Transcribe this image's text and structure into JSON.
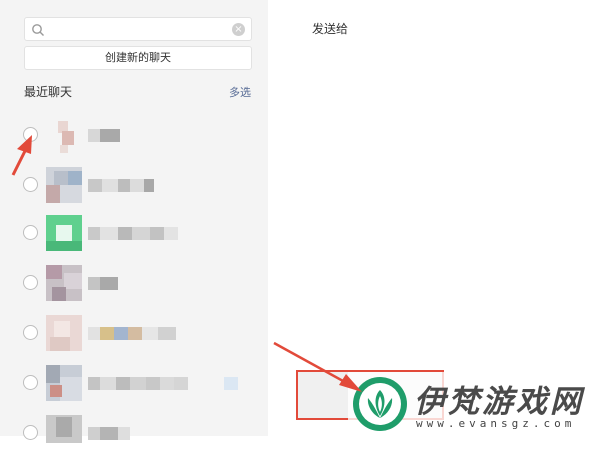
{
  "search": {
    "value": "",
    "placeholder": ""
  },
  "actions": {
    "new_chat_label": "创建新的聊天",
    "multi_select_label": "多选",
    "confirm_label": ""
  },
  "recent": {
    "title": "最近聊天"
  },
  "share": {
    "title": "发送给"
  },
  "watermark": {
    "title": "伊梵游戏网",
    "url": "www.evansgz.com"
  },
  "icons": {
    "search": "search-icon",
    "clear": "clear-icon",
    "radio": "radio-button",
    "annotation": "red-arrow-icon"
  },
  "colors": {
    "link": "#576b95",
    "annotation": "#e24a3a",
    "logo": "#1f9d6a"
  }
}
